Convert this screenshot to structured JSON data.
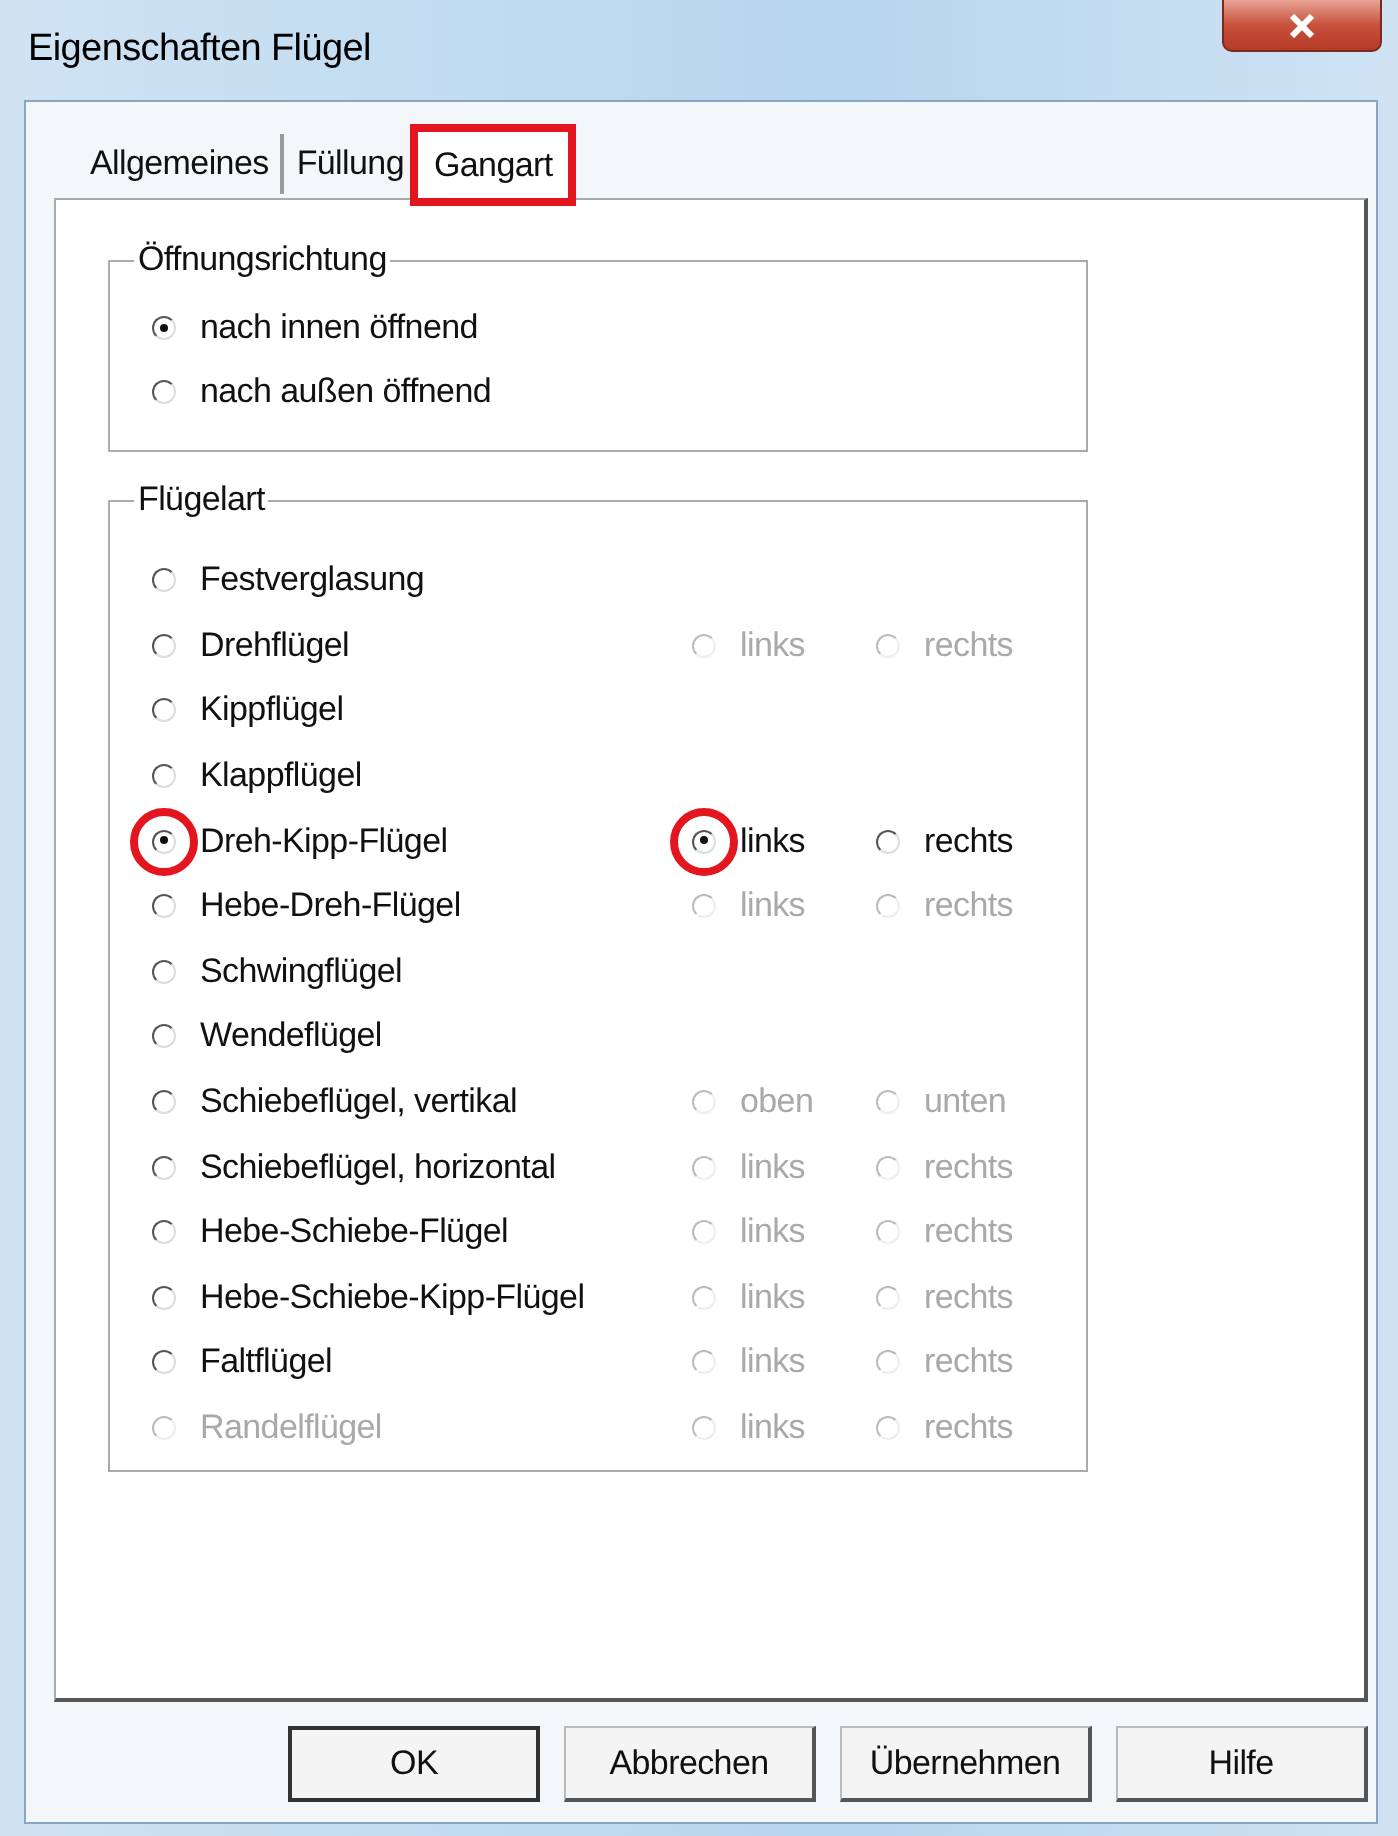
{
  "window": {
    "title": "Eigenschaften Flügel"
  },
  "tabs": [
    {
      "label": "Allgemeines",
      "selected": false
    },
    {
      "label": "Füllung",
      "selected": false
    },
    {
      "label": "Gangart",
      "selected": true,
      "highlighted": true
    }
  ],
  "opening_direction": {
    "title": "Öffnungsrichtung",
    "options": [
      {
        "label": "nach innen öffnend",
        "selected": true
      },
      {
        "label": "nach außen öffnend",
        "selected": false
      }
    ]
  },
  "wing_type": {
    "title": "Flügelart",
    "items": [
      {
        "label": "Festverglasung",
        "selected": false,
        "disabled": false
      },
      {
        "label": "Drehflügel",
        "selected": false,
        "disabled": false,
        "sides": [
          {
            "label": "links",
            "selected": false,
            "disabled": true
          },
          {
            "label": "rechts",
            "selected": false,
            "disabled": true
          }
        ]
      },
      {
        "label": "Kippflügel",
        "selected": false,
        "disabled": false
      },
      {
        "label": "Klappflügel",
        "selected": false,
        "disabled": false
      },
      {
        "label": "Dreh-Kipp-Flügel",
        "selected": true,
        "disabled": false,
        "highlighted": true,
        "sides": [
          {
            "label": "links",
            "selected": true,
            "disabled": false,
            "highlighted": true
          },
          {
            "label": "rechts",
            "selected": false,
            "disabled": false
          }
        ]
      },
      {
        "label": "Hebe-Dreh-Flügel",
        "selected": false,
        "disabled": false,
        "sides": [
          {
            "label": "links",
            "selected": false,
            "disabled": true
          },
          {
            "label": "rechts",
            "selected": false,
            "disabled": true
          }
        ]
      },
      {
        "label": "Schwingflügel",
        "selected": false,
        "disabled": false
      },
      {
        "label": "Wendeflügel",
        "selected": false,
        "disabled": false
      },
      {
        "label": "Schiebeflügel, vertikal",
        "selected": false,
        "disabled": false,
        "sides": [
          {
            "label": "oben",
            "selected": false,
            "disabled": true
          },
          {
            "label": "unten",
            "selected": false,
            "disabled": true
          }
        ]
      },
      {
        "label": "Schiebeflügel, horizontal",
        "selected": false,
        "disabled": false,
        "sides": [
          {
            "label": "links",
            "selected": false,
            "disabled": true
          },
          {
            "label": "rechts",
            "selected": false,
            "disabled": true
          }
        ]
      },
      {
        "label": "Hebe-Schiebe-Flügel",
        "selected": false,
        "disabled": false,
        "sides": [
          {
            "label": "links",
            "selected": false,
            "disabled": true
          },
          {
            "label": "rechts",
            "selected": false,
            "disabled": true
          }
        ]
      },
      {
        "label": "Hebe-Schiebe-Kipp-Flügel",
        "selected": false,
        "disabled": false,
        "sides": [
          {
            "label": "links",
            "selected": false,
            "disabled": true
          },
          {
            "label": "rechts",
            "selected": false,
            "disabled": true
          }
        ]
      },
      {
        "label": "Faltflügel",
        "selected": false,
        "disabled": false,
        "sides": [
          {
            "label": "links",
            "selected": false,
            "disabled": true
          },
          {
            "label": "rechts",
            "selected": false,
            "disabled": true
          }
        ]
      },
      {
        "label": "Randelflügel",
        "selected": false,
        "disabled": true,
        "sides": [
          {
            "label": "links",
            "selected": false,
            "disabled": true
          },
          {
            "label": "rechts",
            "selected": false,
            "disabled": true
          }
        ]
      }
    ]
  },
  "buttons": [
    "OK",
    "Abbrechen",
    "Übernehmen",
    "Hilfe"
  ]
}
